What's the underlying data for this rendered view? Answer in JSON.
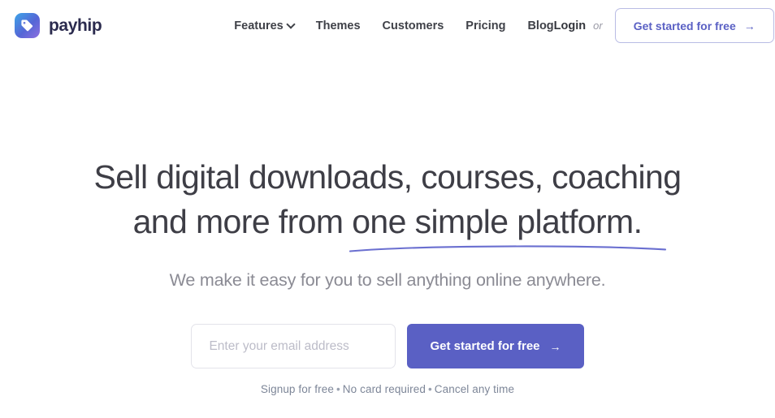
{
  "brand": {
    "name": "payhip",
    "icon": "price-tag-icon",
    "gradient_start": "#3da5e8",
    "gradient_end": "#8f6fe0"
  },
  "nav": {
    "items": [
      {
        "label": "Features",
        "has_dropdown": true
      },
      {
        "label": "Themes",
        "has_dropdown": false
      },
      {
        "label": "Customers",
        "has_dropdown": false
      },
      {
        "label": "Pricing",
        "has_dropdown": false
      },
      {
        "label": "Blog",
        "has_dropdown": false
      }
    ]
  },
  "header_actions": {
    "login_label": "Login",
    "or_label": "or",
    "cta_label": "Get started for free",
    "cta_arrow": "→",
    "cta_text_color": "#5a60c4",
    "cta_border_color": "#b9bce4"
  },
  "hero": {
    "headline_line1": "Sell digital downloads, courses, coaching",
    "headline_line2_prefix": "and more from ",
    "headline_line2_underlined": "one simple platform.",
    "underline_color": "#6a6fd0",
    "subtitle": "We make it easy for you to sell anything online anywhere.",
    "heading_color": "#3e3e46",
    "subtitle_color": "#8b8b94"
  },
  "signup": {
    "email_placeholder": "Enter your email address",
    "email_value": "",
    "submit_label": "Get started for free",
    "submit_arrow": "→",
    "submit_color": "#5a60c4"
  },
  "fineprint": {
    "item1": "Signup for free",
    "sep1": "•",
    "item2": "No card required",
    "sep2": "•",
    "item3": "Cancel any time"
  }
}
